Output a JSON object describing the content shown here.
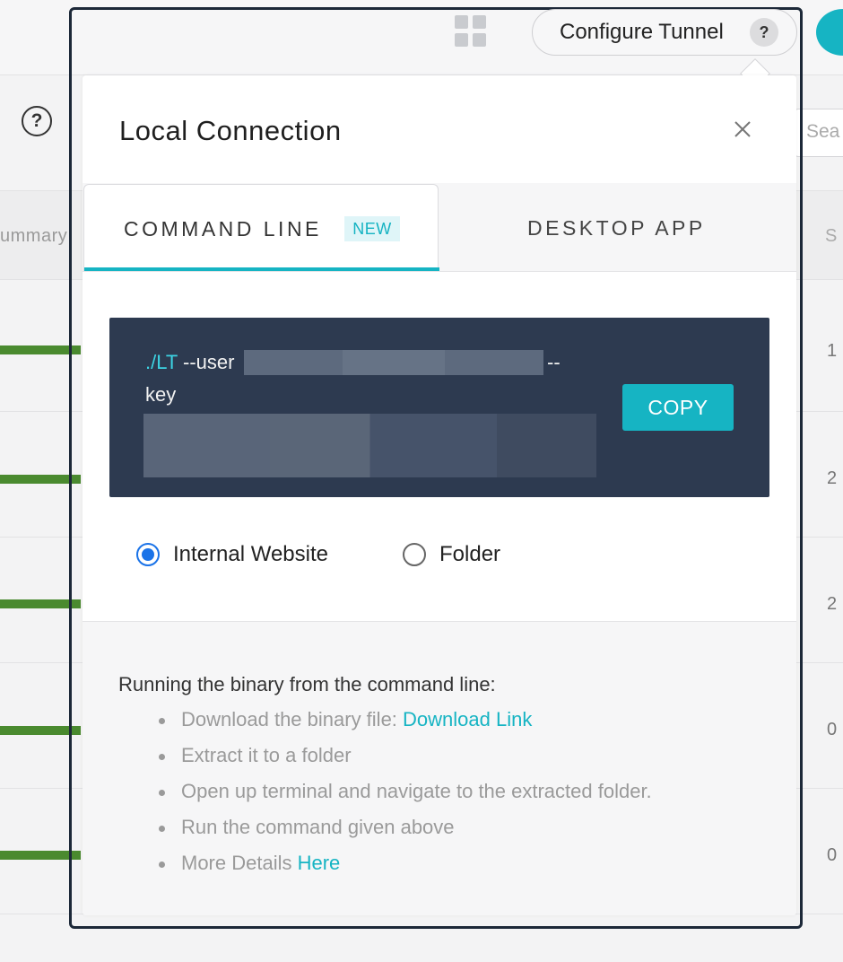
{
  "background": {
    "column_header": "ummary",
    "search_placeholder": "Sea",
    "column_letter": "S",
    "row_values": [
      "1",
      "2",
      "2",
      "0",
      "0"
    ]
  },
  "toolbar": {
    "configure_tunnel_label": "Configure Tunnel",
    "help_glyph": "?"
  },
  "modal": {
    "title": "Local Connection",
    "tabs": [
      {
        "label": "COMMAND LINE",
        "badge": "NEW",
        "selected": true
      },
      {
        "label": "DESKTOP APP",
        "selected": false
      }
    ],
    "command": {
      "prefix": "./LT",
      "user_flag": " --user",
      "key_flag_dashes": "--",
      "key_flag_word": "key",
      "copy_label": "COPY"
    },
    "tunnel_type": {
      "options": [
        {
          "label": "Internal Website",
          "selected": true
        },
        {
          "label": "Folder",
          "selected": false
        }
      ]
    },
    "instructions": {
      "heading": "Running the binary from the command line:",
      "steps": [
        {
          "text": "Download the binary file: ",
          "link": "Download Link"
        },
        {
          "text": "Extract it to a folder"
        },
        {
          "text": "Open up terminal and navigate to the extracted folder."
        },
        {
          "text": "Run the command given above"
        },
        {
          "text": "More Details ",
          "link": "Here"
        }
      ]
    }
  },
  "colors": {
    "accent": "#16b4c3",
    "command_bg": "#2d3a50",
    "radio_selected": "#1a73e8",
    "progress_green": "#4a8a2f"
  }
}
